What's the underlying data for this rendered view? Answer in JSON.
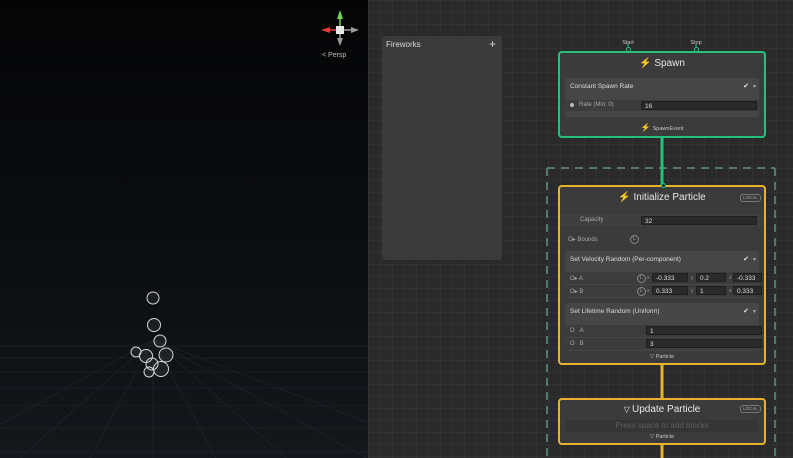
{
  "scene": {
    "persp_label": "< Persp"
  },
  "blackboard": {
    "title": "Fireworks",
    "add_label": "+"
  },
  "spawn": {
    "start_label": "Start",
    "stop_label": "Stop",
    "title": "Spawn",
    "block_title": "Constant Spawn Rate",
    "rate_label": "Rate (Min: 0)",
    "rate_value": "16",
    "event_label": "SpawnEvent"
  },
  "init": {
    "title": "Initialize Particle",
    "space_badge": "LOCAL",
    "capacity_label": "Capacity",
    "capacity_value": "32",
    "bounds_label": "Bounds",
    "velocity": {
      "title": "Set Velocity Random (Per-component)",
      "a_label": "A",
      "b_label": "B",
      "a": {
        "x": "-0.333",
        "y": "0.2",
        "z": "-0.333"
      },
      "b": {
        "x": "0.333",
        "y": "1",
        "z": "0.333"
      }
    },
    "lifetime": {
      "title": "Set Lifetime Random (Uniform)",
      "a_label": "A",
      "a_value": "1",
      "b_label": "B",
      "b_value": "3"
    },
    "particle_label": "Particle"
  },
  "update": {
    "title": "Update Particle",
    "space_badge": "LOCAL",
    "hint": "Press space to add blocks",
    "particle_label": "Particle"
  },
  "colors": {
    "spawn": "#26c07a",
    "particle": "#e8b22e"
  }
}
